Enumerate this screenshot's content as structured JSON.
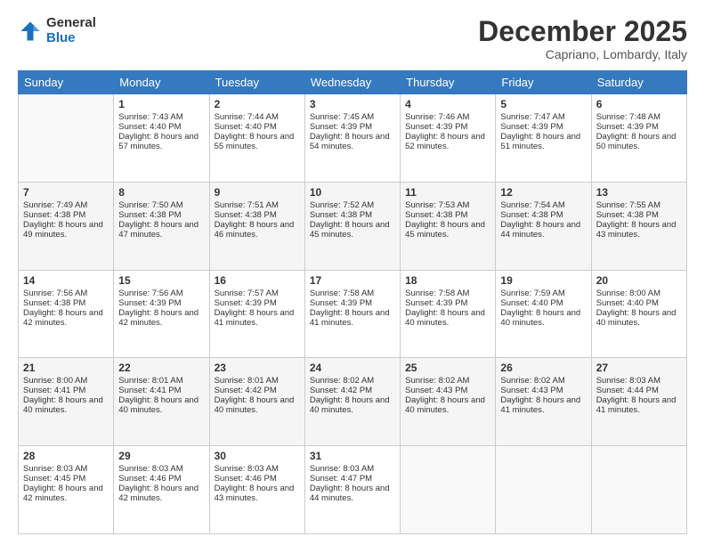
{
  "logo": {
    "general": "General",
    "blue": "Blue"
  },
  "header": {
    "title": "December 2025",
    "location": "Capriano, Lombardy, Italy"
  },
  "days_of_week": [
    "Sunday",
    "Monday",
    "Tuesday",
    "Wednesday",
    "Thursday",
    "Friday",
    "Saturday"
  ],
  "weeks": [
    [
      {
        "day": "",
        "sunrise": "",
        "sunset": "",
        "daylight": ""
      },
      {
        "day": "1",
        "sunrise": "Sunrise: 7:43 AM",
        "sunset": "Sunset: 4:40 PM",
        "daylight": "Daylight: 8 hours and 57 minutes."
      },
      {
        "day": "2",
        "sunrise": "Sunrise: 7:44 AM",
        "sunset": "Sunset: 4:40 PM",
        "daylight": "Daylight: 8 hours and 55 minutes."
      },
      {
        "day": "3",
        "sunrise": "Sunrise: 7:45 AM",
        "sunset": "Sunset: 4:39 PM",
        "daylight": "Daylight: 8 hours and 54 minutes."
      },
      {
        "day": "4",
        "sunrise": "Sunrise: 7:46 AM",
        "sunset": "Sunset: 4:39 PM",
        "daylight": "Daylight: 8 hours and 52 minutes."
      },
      {
        "day": "5",
        "sunrise": "Sunrise: 7:47 AM",
        "sunset": "Sunset: 4:39 PM",
        "daylight": "Daylight: 8 hours and 51 minutes."
      },
      {
        "day": "6",
        "sunrise": "Sunrise: 7:48 AM",
        "sunset": "Sunset: 4:39 PM",
        "daylight": "Daylight: 8 hours and 50 minutes."
      }
    ],
    [
      {
        "day": "7",
        "sunrise": "Sunrise: 7:49 AM",
        "sunset": "Sunset: 4:38 PM",
        "daylight": "Daylight: 8 hours and 49 minutes."
      },
      {
        "day": "8",
        "sunrise": "Sunrise: 7:50 AM",
        "sunset": "Sunset: 4:38 PM",
        "daylight": "Daylight: 8 hours and 47 minutes."
      },
      {
        "day": "9",
        "sunrise": "Sunrise: 7:51 AM",
        "sunset": "Sunset: 4:38 PM",
        "daylight": "Daylight: 8 hours and 46 minutes."
      },
      {
        "day": "10",
        "sunrise": "Sunrise: 7:52 AM",
        "sunset": "Sunset: 4:38 PM",
        "daylight": "Daylight: 8 hours and 45 minutes."
      },
      {
        "day": "11",
        "sunrise": "Sunrise: 7:53 AM",
        "sunset": "Sunset: 4:38 PM",
        "daylight": "Daylight: 8 hours and 45 minutes."
      },
      {
        "day": "12",
        "sunrise": "Sunrise: 7:54 AM",
        "sunset": "Sunset: 4:38 PM",
        "daylight": "Daylight: 8 hours and 44 minutes."
      },
      {
        "day": "13",
        "sunrise": "Sunrise: 7:55 AM",
        "sunset": "Sunset: 4:38 PM",
        "daylight": "Daylight: 8 hours and 43 minutes."
      }
    ],
    [
      {
        "day": "14",
        "sunrise": "Sunrise: 7:56 AM",
        "sunset": "Sunset: 4:38 PM",
        "daylight": "Daylight: 8 hours and 42 minutes."
      },
      {
        "day": "15",
        "sunrise": "Sunrise: 7:56 AM",
        "sunset": "Sunset: 4:39 PM",
        "daylight": "Daylight: 8 hours and 42 minutes."
      },
      {
        "day": "16",
        "sunrise": "Sunrise: 7:57 AM",
        "sunset": "Sunset: 4:39 PM",
        "daylight": "Daylight: 8 hours and 41 minutes."
      },
      {
        "day": "17",
        "sunrise": "Sunrise: 7:58 AM",
        "sunset": "Sunset: 4:39 PM",
        "daylight": "Daylight: 8 hours and 41 minutes."
      },
      {
        "day": "18",
        "sunrise": "Sunrise: 7:58 AM",
        "sunset": "Sunset: 4:39 PM",
        "daylight": "Daylight: 8 hours and 40 minutes."
      },
      {
        "day": "19",
        "sunrise": "Sunrise: 7:59 AM",
        "sunset": "Sunset: 4:40 PM",
        "daylight": "Daylight: 8 hours and 40 minutes."
      },
      {
        "day": "20",
        "sunrise": "Sunrise: 8:00 AM",
        "sunset": "Sunset: 4:40 PM",
        "daylight": "Daylight: 8 hours and 40 minutes."
      }
    ],
    [
      {
        "day": "21",
        "sunrise": "Sunrise: 8:00 AM",
        "sunset": "Sunset: 4:41 PM",
        "daylight": "Daylight: 8 hours and 40 minutes."
      },
      {
        "day": "22",
        "sunrise": "Sunrise: 8:01 AM",
        "sunset": "Sunset: 4:41 PM",
        "daylight": "Daylight: 8 hours and 40 minutes."
      },
      {
        "day": "23",
        "sunrise": "Sunrise: 8:01 AM",
        "sunset": "Sunset: 4:42 PM",
        "daylight": "Daylight: 8 hours and 40 minutes."
      },
      {
        "day": "24",
        "sunrise": "Sunrise: 8:02 AM",
        "sunset": "Sunset: 4:42 PM",
        "daylight": "Daylight: 8 hours and 40 minutes."
      },
      {
        "day": "25",
        "sunrise": "Sunrise: 8:02 AM",
        "sunset": "Sunset: 4:43 PM",
        "daylight": "Daylight: 8 hours and 40 minutes."
      },
      {
        "day": "26",
        "sunrise": "Sunrise: 8:02 AM",
        "sunset": "Sunset: 4:43 PM",
        "daylight": "Daylight: 8 hours and 41 minutes."
      },
      {
        "day": "27",
        "sunrise": "Sunrise: 8:03 AM",
        "sunset": "Sunset: 4:44 PM",
        "daylight": "Daylight: 8 hours and 41 minutes."
      }
    ],
    [
      {
        "day": "28",
        "sunrise": "Sunrise: 8:03 AM",
        "sunset": "Sunset: 4:45 PM",
        "daylight": "Daylight: 8 hours and 42 minutes."
      },
      {
        "day": "29",
        "sunrise": "Sunrise: 8:03 AM",
        "sunset": "Sunset: 4:46 PM",
        "daylight": "Daylight: 8 hours and 42 minutes."
      },
      {
        "day": "30",
        "sunrise": "Sunrise: 8:03 AM",
        "sunset": "Sunset: 4:46 PM",
        "daylight": "Daylight: 8 hours and 43 minutes."
      },
      {
        "day": "31",
        "sunrise": "Sunrise: 8:03 AM",
        "sunset": "Sunset: 4:47 PM",
        "daylight": "Daylight: 8 hours and 44 minutes."
      },
      {
        "day": "",
        "sunrise": "",
        "sunset": "",
        "daylight": ""
      },
      {
        "day": "",
        "sunrise": "",
        "sunset": "",
        "daylight": ""
      },
      {
        "day": "",
        "sunrise": "",
        "sunset": "",
        "daylight": ""
      }
    ]
  ]
}
